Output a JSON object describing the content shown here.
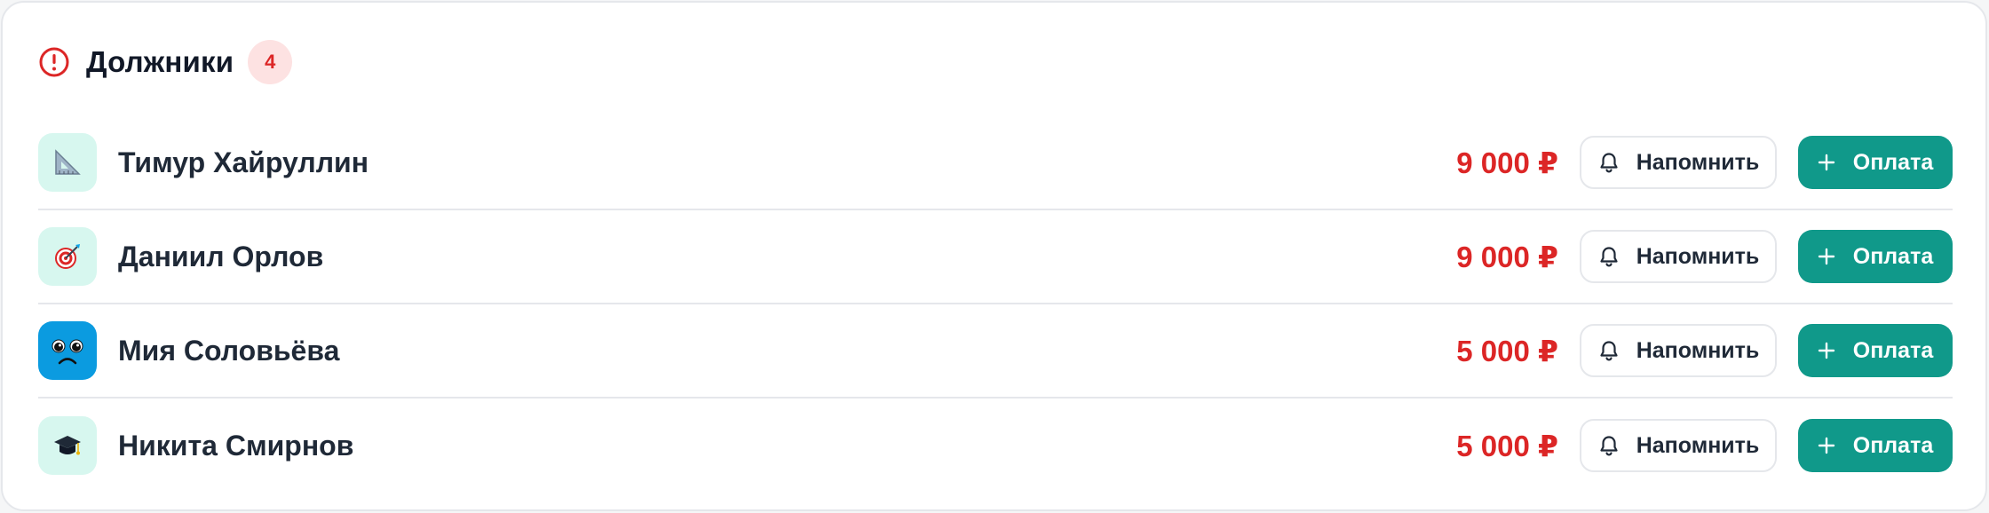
{
  "header": {
    "icon": "alert-circle-icon",
    "title": "Должники",
    "count": "4",
    "accent_color": "#dc2626"
  },
  "debtors": [
    {
      "name": "Тимур Хайруллин",
      "amount": "9 000 ₽",
      "avatar_icon": "triangle-ruler-icon",
      "avatar_bg": "#d7f7ef"
    },
    {
      "name": "Даниил Орлов",
      "amount": "9 000 ₽",
      "avatar_icon": "target-dart-icon",
      "avatar_bg": "#d7f7ef"
    },
    {
      "name": "Мия Соловьёва",
      "amount": "5 000 ₽",
      "avatar_icon": "sad-face-icon",
      "avatar_bg": "#0b9be0"
    },
    {
      "name": "Никита Смирнов",
      "amount": "5 000 ₽",
      "avatar_icon": "graduation-cap-icon",
      "avatar_bg": "#d7f7ef"
    }
  ],
  "actions": {
    "remind_label": "Напомнить",
    "remind_icon": "bell-icon",
    "pay_label": "Оплата",
    "pay_icon": "plus-icon",
    "pay_color": "#10998a"
  }
}
